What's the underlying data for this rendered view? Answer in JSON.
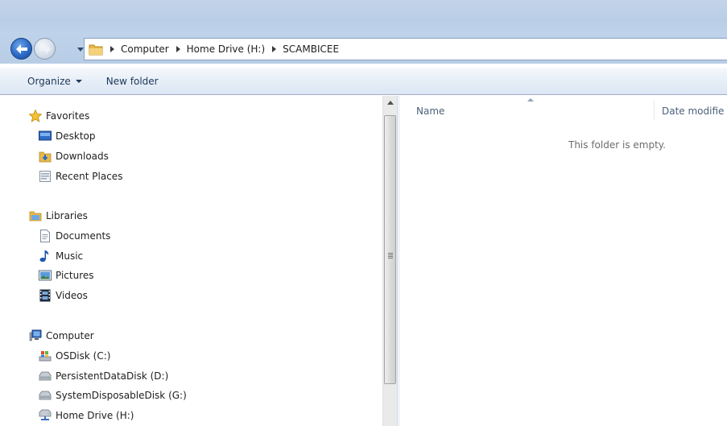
{
  "navigation": {
    "breadcrumb": [
      "Computer",
      "Home Drive (H:)",
      "SCAMBICEE"
    ]
  },
  "toolbar": {
    "organize_label": "Organize",
    "new_folder_label": "New folder"
  },
  "sidebar": {
    "favorites": {
      "label": "Favorites",
      "icon": "star-icon",
      "items": [
        {
          "label": "Desktop",
          "icon": "desktop-icon"
        },
        {
          "label": "Downloads",
          "icon": "downloads-icon"
        },
        {
          "label": "Recent Places",
          "icon": "recent-places-icon"
        }
      ]
    },
    "libraries": {
      "label": "Libraries",
      "icon": "libraries-icon",
      "items": [
        {
          "label": "Documents",
          "icon": "documents-icon"
        },
        {
          "label": "Music",
          "icon": "music-icon"
        },
        {
          "label": "Pictures",
          "icon": "pictures-icon"
        },
        {
          "label": "Videos",
          "icon": "videos-icon"
        }
      ]
    },
    "computer": {
      "label": "Computer",
      "icon": "computer-icon",
      "items": [
        {
          "label": "OSDisk (C:)",
          "icon": "os-disk-icon"
        },
        {
          "label": "PersistentDataDisk (D:)",
          "icon": "drive-icon"
        },
        {
          "label": "SystemDisposableDisk (G:)",
          "icon": "drive-icon"
        },
        {
          "label": "Home Drive (H:)",
          "icon": "network-drive-icon"
        }
      ]
    }
  },
  "content": {
    "columns": {
      "name": "Name",
      "date": "Date modifie"
    },
    "empty_message": "This folder is empty."
  },
  "colors": {
    "title_band": "#c3d4e8",
    "command_text": "#1e395b",
    "back_button": "#2c6ac6",
    "folder_yellow": "#e8b84a"
  }
}
